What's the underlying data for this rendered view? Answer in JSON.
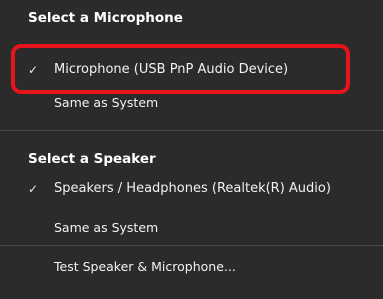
{
  "menu": {
    "microphone_section": {
      "heading": "Select a Microphone",
      "items": [
        {
          "label": "Microphone (USB PnP Audio Device)",
          "check": "✓"
        },
        {
          "label": "Same as System",
          "check": ""
        }
      ]
    },
    "speaker_section": {
      "heading": "Select a Speaker",
      "items": [
        {
          "label": "Speakers / Headphones (Realtek(R) Audio)",
          "check": "✓"
        },
        {
          "label": "Same as System",
          "check": ""
        }
      ]
    },
    "test_item": {
      "label": "Test Speaker & Microphone..."
    }
  },
  "colors": {
    "background": "#2b2b2b",
    "text": "#ffffff",
    "highlight_border": "#e8141c",
    "divider": "#4a4a4a"
  },
  "icons": {
    "selected": "checkmark-icon"
  }
}
